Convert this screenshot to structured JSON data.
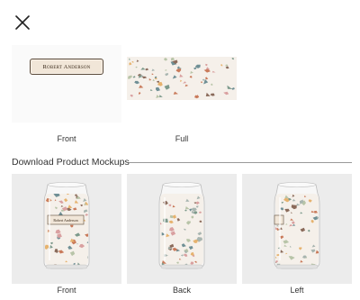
{
  "close_icon": "close-icon",
  "previews": [
    {
      "caption": "Front",
      "label": "Robert Anderson"
    },
    {
      "caption": "Full"
    }
  ],
  "section": {
    "title": "Download Product Mockups"
  },
  "mockups": [
    {
      "caption": "Front",
      "label": "Robert Anderson"
    },
    {
      "caption": "Back"
    },
    {
      "caption": "Left"
    }
  ],
  "colors": {
    "terrazzo": [
      "#7d9a8c",
      "#c97a5a",
      "#e6b26e",
      "#a8b5b0",
      "#8a6a5a",
      "#6f8f95",
      "#d9a0a0",
      "#b8c4a8"
    ],
    "background": "#f5f0ea"
  }
}
